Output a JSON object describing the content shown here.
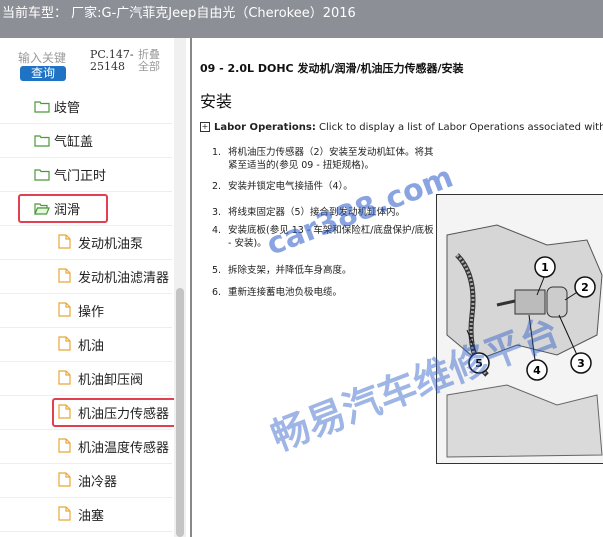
{
  "header": {
    "title": "当前车型： 厂家:G-广汽菲克Jeep自由光（Cherokee）2016"
  },
  "search": {
    "placeholder": "输入关键",
    "button_label": "查询",
    "pc_code": "PC.147-25148",
    "collapse_label": "折叠全部"
  },
  "tree": {
    "items": [
      {
        "label": "歧管",
        "type": "folder",
        "highlighted": false
      },
      {
        "label": "气缸盖",
        "type": "folder",
        "highlighted": false
      },
      {
        "label": "气门正时",
        "type": "folder",
        "highlighted": false
      },
      {
        "label": "润滑",
        "type": "folder-open",
        "highlighted": true
      },
      {
        "label": "发动机油泵",
        "type": "document",
        "highlighted": false
      },
      {
        "label": "发动机油滤清器",
        "type": "document",
        "highlighted": false
      },
      {
        "label": "操作",
        "type": "document",
        "highlighted": false
      },
      {
        "label": "机油",
        "type": "document",
        "highlighted": false
      },
      {
        "label": "机油卸压阀",
        "type": "document",
        "highlighted": false
      },
      {
        "label": "机油压力传感器",
        "type": "document",
        "highlighted": true
      },
      {
        "label": "机油温度传感器",
        "type": "document",
        "highlighted": false
      },
      {
        "label": "油冷器",
        "type": "document",
        "highlighted": false
      },
      {
        "label": "油塞",
        "type": "document",
        "highlighted": false
      }
    ]
  },
  "document": {
    "title": "09 - 2.0L DOHC 发动机/润滑/机油压力传感器/安装",
    "section": "安装",
    "labor_expand": "+",
    "labor_heading": "Labor Operations:",
    "labor_text": "Click to display a list of Labor Operations associated with this proce",
    "steps": [
      {
        "num": "1.",
        "text": "将机油压力传感器（2）安装至发动机缸体。将其紧至适当的(参见 09 - 扭矩规格)。"
      },
      {
        "num": "2.",
        "text": "安装并锁定电气接插件（4）。"
      },
      {
        "num": "3.",
        "text": "将线束固定器（5）接合到发动机缸体内。"
      },
      {
        "num": "4.",
        "text": "安装底板(参见 13 - 车架和保险杠/底盘保护/底板 - 安装)。"
      },
      {
        "num": "5.",
        "text": "拆除支架，并降低车身高度。"
      },
      {
        "num": "6.",
        "text": "重新连接蓄电池负极电缆。"
      }
    ],
    "figure_callouts": [
      "1",
      "2",
      "3",
      "4",
      "5"
    ]
  },
  "watermark": {
    "line1": "car388.com",
    "line2": "畅易汽车维修平台"
  },
  "colors": {
    "header_bg": "#8c8f96",
    "search_button": "#1e73c5",
    "highlight": "#e0404f",
    "link": "#1f5fb0",
    "watermark": "#2a5ac8"
  }
}
